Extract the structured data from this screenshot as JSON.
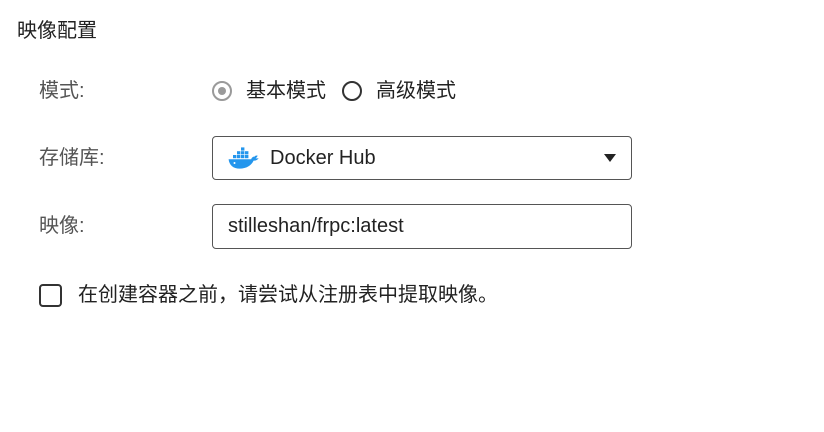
{
  "section": {
    "title": "映像配置"
  },
  "mode": {
    "label": "模式:",
    "options": [
      {
        "label": "基本模式",
        "checked": true
      },
      {
        "label": "高级模式",
        "checked": false
      }
    ]
  },
  "repository": {
    "label": "存储库:",
    "selected": "Docker Hub",
    "icon": "docker-whale-icon",
    "icon_color": "#2496ed"
  },
  "image": {
    "label": "映像:",
    "value": "stilleshan/frpc:latest"
  },
  "pull_option": {
    "label": "在创建容器之前，请尝试从注册表中提取映像。",
    "checked": false
  }
}
